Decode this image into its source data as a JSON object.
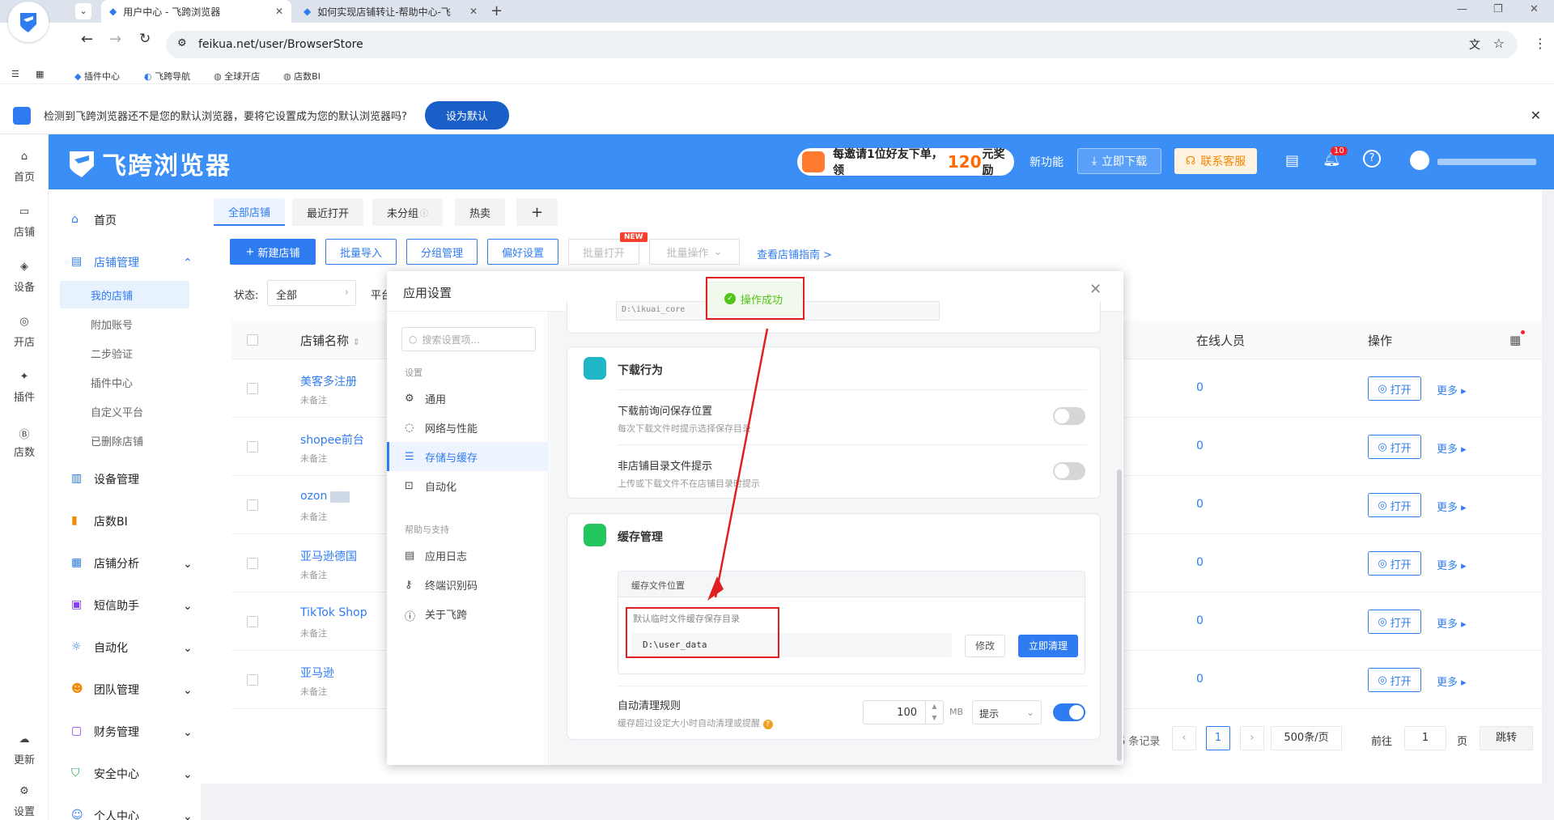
{
  "browser": {
    "tabs": [
      {
        "label": "用户中心 - 飞跨浏览器"
      },
      {
        "label": "如何实现店铺转让-帮助中心-飞"
      }
    ],
    "url": "feikua.net/user/BrowserStore",
    "bookmarks": [
      "插件中心",
      "飞跨导航",
      "全球开店",
      "店数BI"
    ]
  },
  "notification": {
    "text": "检测到飞跨浏览器还不是您的默认浏览器，要将它设置成为您的默认浏览器吗?",
    "button": "设为默认"
  },
  "header": {
    "logo": "飞跨浏览器",
    "promo_prefix": "每邀请1位好友下单，领",
    "promo_amount": "120",
    "promo_suffix": "元奖励",
    "new_feature": "新功能",
    "download": "立即下载",
    "support": "联系客服",
    "notif_count": "10"
  },
  "rail": [
    "首页",
    "店铺",
    "设备",
    "开店",
    "插件",
    "店数",
    "更新",
    "设置"
  ],
  "sidebar": {
    "items": [
      {
        "label": "首页"
      },
      {
        "label": "店铺管理"
      },
      {
        "label": "设备管理"
      },
      {
        "label": "店数BI"
      },
      {
        "label": "店铺分析"
      },
      {
        "label": "短信助手"
      },
      {
        "label": "自动化"
      },
      {
        "label": "团队管理"
      },
      {
        "label": "财务管理"
      },
      {
        "label": "安全中心"
      },
      {
        "label": "个人中心"
      }
    ],
    "sub_items": [
      "我的店铺",
      "附加账号",
      "二步验证",
      "插件中心",
      "自定义平台",
      "已删除店铺"
    ]
  },
  "main": {
    "tabs": [
      "全部店铺",
      "最近打开",
      "未分组",
      "热卖"
    ],
    "buttons": {
      "new_shop": "新建店铺",
      "batch_import": "批量导入",
      "group_manage": "分组管理",
      "preferences": "偏好设置",
      "batch_open": "批量打开",
      "batch_ops": "批量操作",
      "guide": "查看店铺指南 >",
      "new_badge": "NEW"
    },
    "filter": {
      "status_label": "状态:",
      "status_value": "全部",
      "platform_label": "平台"
    },
    "columns": {
      "name": "店铺名称",
      "online": "在线人员",
      "actions": "操作"
    },
    "rows": [
      {
        "name": "美客多注册",
        "note": "未备注",
        "online": "0"
      },
      {
        "name": "shopee前台",
        "note": "未备注",
        "online": "0"
      },
      {
        "name": "ozon",
        "note": "未备注",
        "online": "0"
      },
      {
        "name": "亚马逊德国",
        "note": "未备注",
        "online": "0"
      },
      {
        "name": "TikTok Shop",
        "note": "未备注",
        "online": "0"
      },
      {
        "name": "亚马逊",
        "note": "未备注",
        "online": "0"
      }
    ],
    "open_label": "打开",
    "more_label": "更多",
    "pagination": {
      "records": "6 条记录",
      "page": "1",
      "page_size": "500条/页",
      "goto_label": "前往",
      "goto_value": "1",
      "page_unit": "页",
      "jump": "跳转"
    }
  },
  "modal": {
    "title": "应用设置",
    "search_placeholder": "搜索设置项...",
    "nav_section1": "设置",
    "nav_items1": [
      "通用",
      "网络与性能",
      "存储与缓存",
      "自动化"
    ],
    "nav_section2": "帮助与支持",
    "nav_items2": [
      "应用日志",
      "终端识别码",
      "关于飞跨"
    ],
    "partial_path": "D:\\ikuai_core",
    "download_section": {
      "title": "下载行为",
      "settings": [
        {
          "title": "下载前询问保存位置",
          "desc": "每次下载文件时提示选择保存目录"
        },
        {
          "title": "非店铺目录文件提示",
          "desc": "上传或下载文件不在店铺目录时提示"
        }
      ]
    },
    "cache_section": {
      "title": "缓存管理",
      "location_header": "缓存文件位置",
      "location_label": "默认临时文件缓存保存目录",
      "path": "D:\\user_data",
      "modify": "修改",
      "clear": "立即清理",
      "auto_title": "自动清理规则",
      "auto_desc": "缓存超过设定大小时自动清理或提醒",
      "size": "100",
      "unit": "MB",
      "mode": "提示"
    },
    "toast": "操作成功"
  },
  "colors": {
    "accent": "#2f7cf0",
    "header": "#3a8ef6",
    "annotation": "#e02020",
    "success": "#52c41a"
  }
}
